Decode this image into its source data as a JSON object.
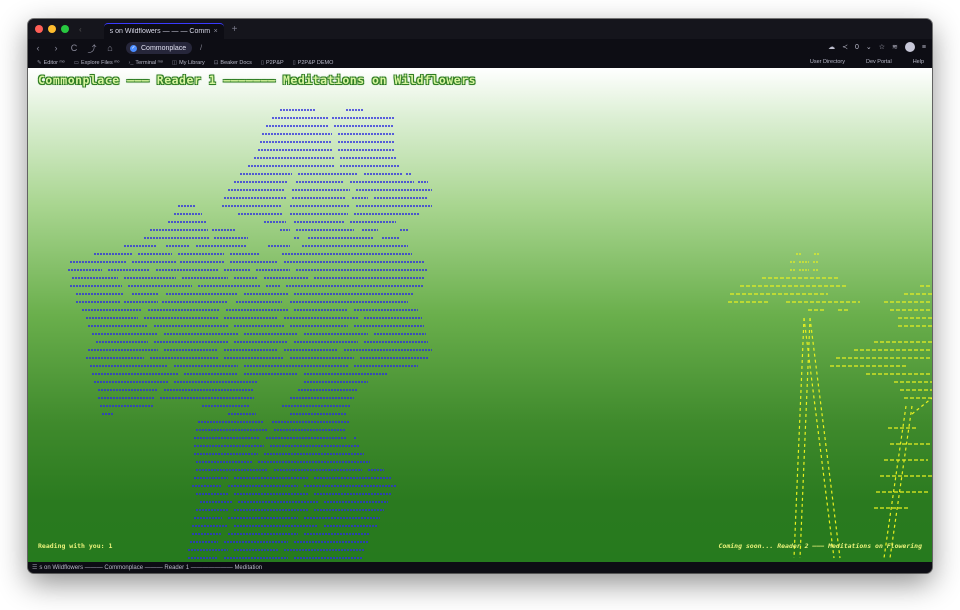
{
  "tab": {
    "title": "s on Wildflowers — — — Commonplac...",
    "close": "×",
    "new": "+"
  },
  "nav": {
    "back": "‹",
    "forward": "›",
    "reload": "C",
    "upload": "⤴",
    "home": "⌂",
    "url": "Commonplace",
    "slash": "/",
    "share_count": "0"
  },
  "bookmarks": [
    {
      "icon": "✎",
      "label": "Editor ᵐᵒ"
    },
    {
      "icon": "▭",
      "label": "Explore Files ᵐᵒ"
    },
    {
      "icon": "›_",
      "label": "Terminal ᵐᵒ"
    },
    {
      "icon": "◫",
      "label": "My Library"
    },
    {
      "icon": "⊡",
      "label": "Beaker Docs"
    },
    {
      "icon": "▯",
      "label": "P2P&P"
    },
    {
      "icon": "▯",
      "label": "P2P&P DEMO"
    }
  ],
  "bookmarks_right": [
    "User Directory",
    "Dev Portal",
    "Help"
  ],
  "page": {
    "title": "Commonplace ——— Reader 1 ——————— Meditations on Wildflowers",
    "footer_left": "Reading with you: 1",
    "footer_right": "Coming soon... Reader 2 ——— Meditations on Flowering"
  },
  "status": {
    "text": "s on Wildflowers ——— Commonplace ——— Reader 1 ——————— Meditation"
  },
  "colors": {
    "blue_art": "#2d2de0",
    "yellow_art": "#e8f020",
    "title_text": "#d8f5a0"
  }
}
